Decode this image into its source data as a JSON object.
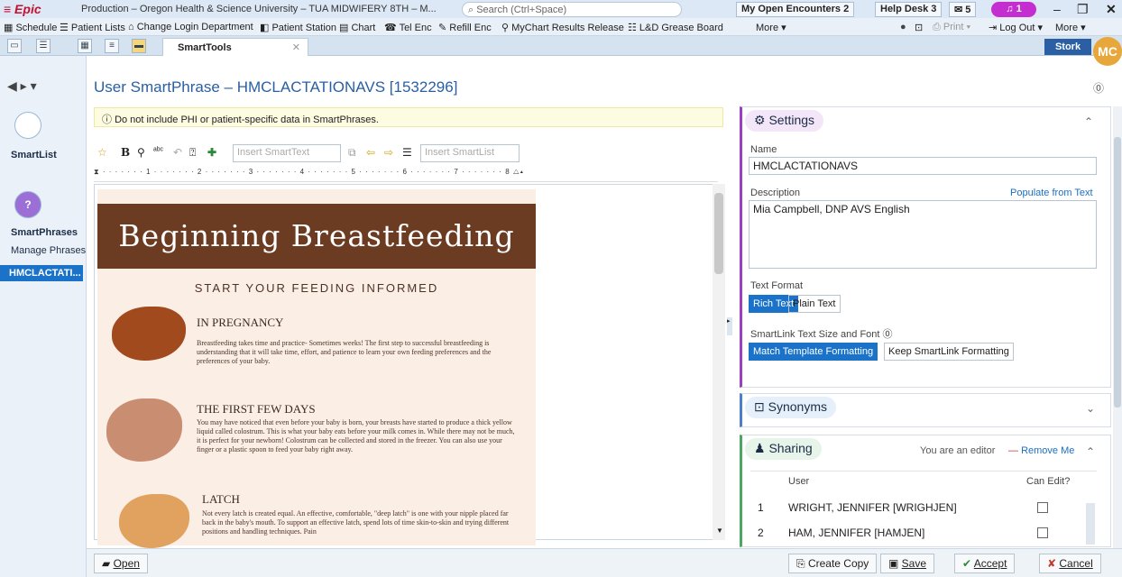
{
  "titlebar": {
    "logo": "≡ Epic",
    "title": "Production – Oregon Health & Science University – TUA MIDWIFERY 8TH – M...",
    "search_placeholder": "Search (Ctrl+Space)",
    "open_encounters": "My Open Encounters 2",
    "help_desk": "Help Desk 3",
    "messages": "5",
    "notifications": "1"
  },
  "toolbar": {
    "schedule": "Schedule",
    "patient_lists": "Patient Lists",
    "change_login": "Change Login Department",
    "patient_station": "Patient Station",
    "chart": "Chart",
    "tel_enc": "Tel Enc",
    "refill_enc": "Refill Enc",
    "mychart_results": "MyChart Results Release",
    "grease_board": "L&D Grease Board",
    "more": "More",
    "print": "Print",
    "log_out": "Log Out",
    "more_right": "More"
  },
  "tabs": {
    "smarttools": "SmartTools",
    "stork": "Stork",
    "avatar": "MC"
  },
  "leftnav": {
    "smartlist": "SmartList",
    "smartphrases": "SmartPhrases",
    "manage_phrases": "Manage Phrases",
    "active_item": "HMCLACTATI..."
  },
  "page": {
    "title": "User SmartPhrase – HMCLACTATIONAVS [1532296]",
    "warning": "Do not include PHI or patient-specific data in SmartPhrases.",
    "insert_smarttext": "Insert SmartText",
    "insert_smartlist": "Insert SmartList"
  },
  "document": {
    "banner": "Beginning Breastfeeding",
    "subhead": "START YOUR FEEDING INFORMED",
    "sections": [
      {
        "title": "IN PREGNANCY",
        "body": "Breastfeeding takes time and practice- Sometimes weeks! The first step to successful breastfeeding is understanding that it will take time, effort, and patience to learn your own feeding preferences and the preferences of your baby."
      },
      {
        "title": "THE FIRST FEW DAYS",
        "body": "You may have noticed that even before your baby is born, your breasts have started to produce a thick yellow liquid called colostrum. This is what your baby eats before your milk comes in. While there may not be much, it is perfect for your newborn! Colostrum can be collected and stored in the freezer. You can also use your finger or a plastic spoon to feed your baby right away."
      },
      {
        "title": "LATCH",
        "body": "Not every latch is created equal. An effective, comfortable, \"deep latch\" is one with your nipple placed far back in the baby's mouth. To support an effective latch, spend lots of time skin-to-skin and trying different positions and handling techniques. Pain"
      }
    ]
  },
  "settings": {
    "header": "Settings",
    "name_label": "Name",
    "name_value": "HMCLACTATIONAVS",
    "description_label": "Description",
    "populate_link": "Populate from Text",
    "description_value": "Mia Campbell, DNP AVS English",
    "text_format_label": "Text Format",
    "rich_text": "Rich Text",
    "plain_text": "Plain Text",
    "smartlink_label": "SmartLink Text Size and Font",
    "match_template": "Match Template Formatting",
    "keep_smartlink": "Keep SmartLink Formatting"
  },
  "synonyms": {
    "header": "Synonyms"
  },
  "sharing": {
    "header": "Sharing",
    "editor_note": "You are an editor",
    "remove_me": "Remove Me",
    "col_user": "User",
    "col_can_edit": "Can Edit?",
    "rows": [
      {
        "num": "1",
        "user": "WRIGHT, JENNIFER [WRIGHJEN]"
      },
      {
        "num": "2",
        "user": "HAM, JENNIFER [HAMJEN]"
      }
    ]
  },
  "bottombar": {
    "open": "Open",
    "create_copy": "Create Copy",
    "save": "Save",
    "accept": "Accept",
    "cancel": "Cancel"
  }
}
